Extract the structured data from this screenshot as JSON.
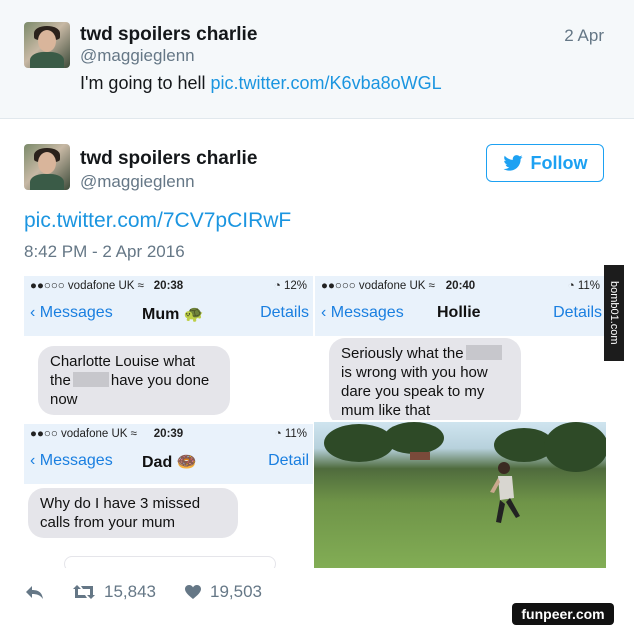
{
  "quoted": {
    "name": "twd spoilers charlie",
    "handle": "@maggieglenn",
    "date": "2 Apr",
    "text": "I'm going to hell ",
    "link": "pic.twitter.com/K6vba8oWGL"
  },
  "tweet": {
    "name": "twd spoilers charlie",
    "handle": "@maggieglenn",
    "follow_label": "Follow",
    "pic_link": "pic.twitter.com/7CV7pCIRwF",
    "timestamp": "8:42 PM - 2 Apr 2016"
  },
  "media": {
    "screens": [
      {
        "carrier": "●●○○○ vodafone UK ≈",
        "time": "20:38",
        "battery": "◔ 12%",
        "back": "Messages",
        "contact": "Mum 🐢",
        "details": "Details",
        "msg_a": "Charlotte Louise what",
        "msg_b": "the",
        "msg_c": "have you done",
        "msg_d": "now"
      },
      {
        "carrier": "●●○○○ vodafone UK ≈",
        "time": "20:40",
        "battery": "◔ 11%",
        "back": "Messages",
        "contact": "Hollie",
        "details": "Details",
        "msg_a": "Seriously what the",
        "msg_b": "is wrong with you how",
        "msg_c": "dare you speak to my",
        "msg_d": "mum like that"
      },
      {
        "carrier": "●●○○ vodafone UK ≈",
        "time": "20:39",
        "battery": "◔ 11%",
        "back": "Messages",
        "contact": "Dad 🍩",
        "details": "Detail",
        "msg_a": "Why do I have 3 missed",
        "msg_b": "calls from your mum"
      }
    ]
  },
  "actions": {
    "retweets": "15,843",
    "likes": "19,503"
  },
  "watermarks": {
    "side": "bomb01.com",
    "corner": "funpeer.com"
  }
}
